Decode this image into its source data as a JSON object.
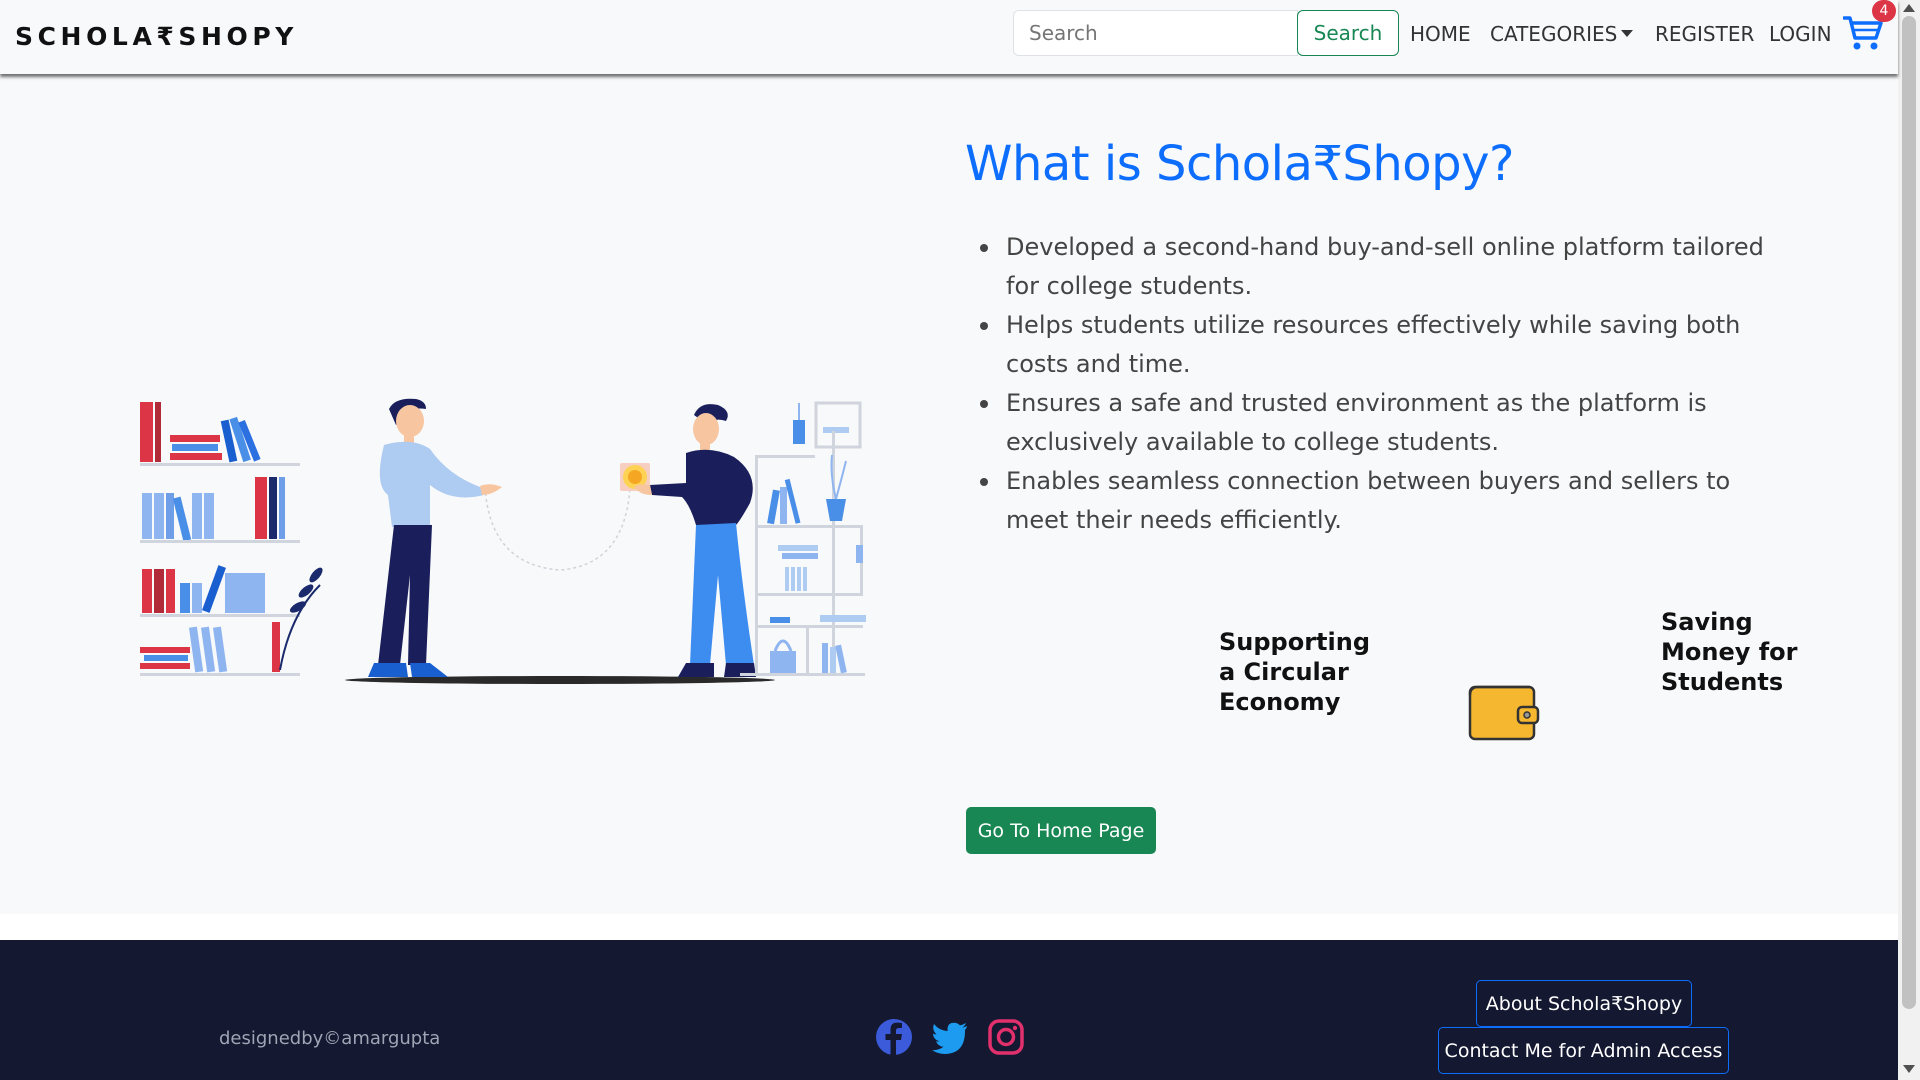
{
  "navbar": {
    "brand": "SCHOLA₹SHOPY",
    "search_placeholder": "Search",
    "search_button": "Search",
    "links": [
      "HOME",
      "CATEGORIES",
      "REGISTER",
      "LOGIN"
    ],
    "cart_count": "4"
  },
  "main": {
    "heading": "What is Schola₹Shopy?",
    "bullets": [
      "Developed a second-hand buy-and-sell online platform tailored for college students.",
      "Helps students utilize resources effectively while saving both costs and time.",
      "Ensures a safe and trusted environment as the platform is exclusively available to college students.",
      "Enables seamless connection between buyers and sellers to meet their needs efficiently."
    ],
    "features": [
      "Supporting a Circular Economy",
      "Saving Money for Students"
    ],
    "home_button": "Go To Home Page"
  },
  "footer": {
    "credit": "designedby©amargupta",
    "about_button": "About Schola₹Shopy",
    "contact_button": "Contact Me for Admin Access",
    "social_icons": [
      "facebook-icon",
      "twitter-icon",
      "instagram-icon"
    ]
  },
  "colors": {
    "primary": "#0d6efd",
    "success": "#198754",
    "danger": "#dc3545",
    "footer_bg": "#141830",
    "page_bg": "#f8f9fa"
  }
}
